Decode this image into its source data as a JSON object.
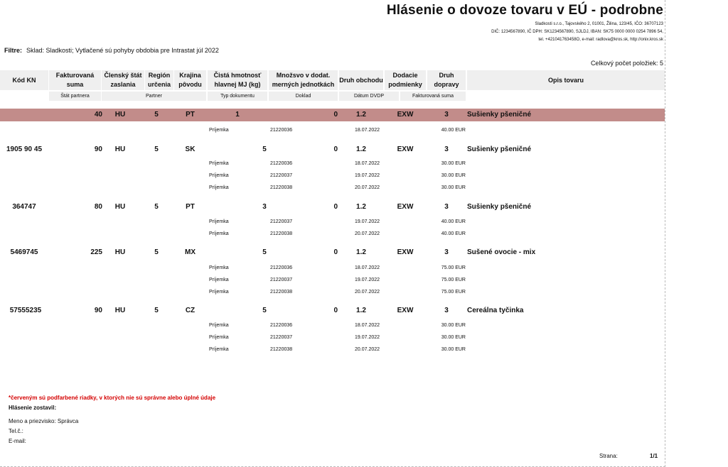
{
  "report": {
    "title": "Hlásenie o dovoze tovaru v EÚ - podrobne",
    "company_lines": [
      "Sladkosti s.r.o., Tajovského 2, 01001, Žilina, 123/45, IČO: 36707123",
      "DIČ: 1234567890, IČ DPH: SK1234567890, SJLDJ, IBAN: SK75 0000 0000 0254 7896 54,",
      "tel. +421041763458O, e-mail: radlova@kros.sk, http://onix.kros.sk"
    ],
    "filter_label": "Filtre:",
    "filter_text": "Sklad: Sladkosti; Vytlačené sú pohyby obdobia pre Intrastat júl 2022",
    "count_label": "Celkový počet položiek: 5"
  },
  "columns": {
    "kod_kn": "Kód KN",
    "fakturovana_suma": "Fakturovaná suma",
    "clensky_stat": "Členský štát zaslania",
    "region": "Región určenia",
    "krajina": "Krajina pôvodu",
    "hmotnost": "Čistá hmotnosť hlavnej MJ (kg)",
    "mnozstvo": "Množsvo v dodat. merných jednotkách",
    "druh_obchodu": "Druh obchodu",
    "dodacie": "Dodacie podmienky",
    "druh_dopravy": "Druh dopravy",
    "opis": "Opis tovaru"
  },
  "subcolumns": {
    "stat_partnera": "Štát partnera",
    "partner": "Partner",
    "typ_dokumentu": "Typ dokumentu",
    "doklad": "Doklad",
    "datum": "Dátum DVDP",
    "fakt_suma": "Fakturovaná suma"
  },
  "items": [
    {
      "kod": "",
      "suma": "40",
      "stat": "HU",
      "region": "5",
      "krajina": "PT",
      "hmotnost": "1",
      "mnozstvo": "0",
      "obchod": "1.2",
      "dodacie": "EXW",
      "doprava": "3",
      "opis": "Sušienky pšeničné",
      "highlight": true,
      "docs": [
        {
          "typ": "Príjemka",
          "doklad": "21220036",
          "datum": "18.07.2022",
          "suma": "40.00 EUR"
        }
      ]
    },
    {
      "kod": "1905 90 45",
      "suma": "90",
      "stat": "HU",
      "region": "5",
      "krajina": "SK",
      "hmotnost": "5",
      "mnozstvo": "0",
      "obchod": "1.2",
      "dodacie": "EXW",
      "doprava": "3",
      "opis": "Sušienky pšeničné",
      "highlight": false,
      "docs": [
        {
          "typ": "Príjemka",
          "doklad": "21220036",
          "datum": "18.07.2022",
          "suma": "30.00 EUR"
        },
        {
          "typ": "Príjemka",
          "doklad": "21220037",
          "datum": "19.07.2022",
          "suma": "30.00 EUR"
        },
        {
          "typ": "Príjemka",
          "doklad": "21220038",
          "datum": "20.07.2022",
          "suma": "30.00 EUR"
        }
      ]
    },
    {
      "kod": "364747",
      "suma": "80",
      "stat": "HU",
      "region": "5",
      "krajina": "PT",
      "hmotnost": "3",
      "mnozstvo": "0",
      "obchod": "1.2",
      "dodacie": "EXW",
      "doprava": "3",
      "opis": "Sušienky pšeničné",
      "highlight": false,
      "docs": [
        {
          "typ": "Príjemka",
          "doklad": "21220037",
          "datum": "19.07.2022",
          "suma": "40.00 EUR"
        },
        {
          "typ": "Príjemka",
          "doklad": "21220038",
          "datum": "20.07.2022",
          "suma": "40.00 EUR"
        }
      ]
    },
    {
      "kod": "5469745",
      "suma": "225",
      "stat": "HU",
      "region": "5",
      "krajina": "MX",
      "hmotnost": "5",
      "mnozstvo": "0",
      "obchod": "1.2",
      "dodacie": "EXW",
      "doprava": "3",
      "opis": "Sušené ovocie - mix",
      "highlight": false,
      "docs": [
        {
          "typ": "Príjemka",
          "doklad": "21220036",
          "datum": "18.07.2022",
          "suma": "75.00 EUR"
        },
        {
          "typ": "Príjemka",
          "doklad": "21220037",
          "datum": "19.07.2022",
          "suma": "75.00 EUR"
        },
        {
          "typ": "Príjemka",
          "doklad": "21220038",
          "datum": "20.07.2022",
          "suma": "75.00 EUR"
        }
      ]
    },
    {
      "kod": "57555235",
      "suma": "90",
      "stat": "HU",
      "region": "5",
      "krajina": "CZ",
      "hmotnost": "5",
      "mnozstvo": "0",
      "obchod": "1.2",
      "dodacie": "EXW",
      "doprava": "3",
      "opis": "Cereálna tyčinka",
      "highlight": false,
      "docs": [
        {
          "typ": "Príjemka",
          "doklad": "21220036",
          "datum": "18.07.2022",
          "suma": "30.00 EUR"
        },
        {
          "typ": "Príjemka",
          "doklad": "21220037",
          "datum": "19.07.2022",
          "suma": "30.00 EUR"
        },
        {
          "typ": "Príjemka",
          "doklad": "21220038",
          "datum": "20.07.2022",
          "suma": "30.00 EUR"
        }
      ]
    }
  ],
  "footer": {
    "note": "*červeným sú podfarbené riadky, v ktorých nie sú správne alebo úplné údaje",
    "prepared_label": "Hlásenie zostavil:",
    "name_label": "Meno a priezvisko: Správca",
    "tel_label": "Tel.č.:",
    "email_label": "E-mail:",
    "page_label": "Strana:",
    "page_value": "1/1"
  },
  "colors": {
    "highlight_row": "#c28c8a",
    "header_bg": "#efefef",
    "note_red": "#d40000"
  }
}
